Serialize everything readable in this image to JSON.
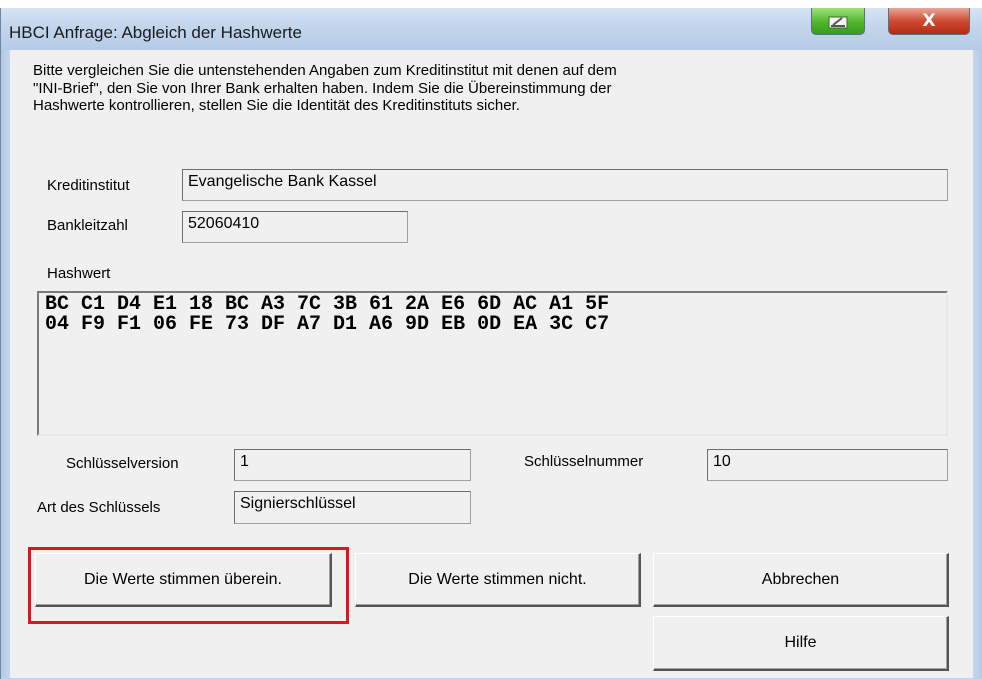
{
  "window": {
    "title": "HBCI Anfrage: Abgleich der Hashwerte",
    "minimize_icon": "minimize-icon",
    "close_icon": "close-icon",
    "close_glyph": "X"
  },
  "description": "Bitte vergleichen Sie die untenstehenden Angaben zum Kreditinstitut mit denen auf dem\n\"INI-Brief\", den Sie von Ihrer Bank erhalten haben. Indem Sie die Übereinstimmung der\nHashwerte kontrollieren, stellen Sie die Identität des Kreditinstituts sicher.",
  "fields": {
    "kreditinstitut": {
      "label": "Kreditinstitut",
      "value": "Evangelische Bank Kassel"
    },
    "bankleitzahl": {
      "label": "Bankleitzahl",
      "value": "52060410"
    },
    "hashwert": {
      "label": "Hashwert",
      "lines": [
        "BC C1 D4 E1 18 BC A3 7C 3B 61 2A E6 6D AC A1 5F",
        "04 F9 F1 06 FE 73 DF A7 D1 A6 9D EB 0D EA 3C C7"
      ]
    },
    "schluesselversion": {
      "label": "Schlüsselversion",
      "value": "1"
    },
    "schluesselnummer": {
      "label": "Schlüsselnummer",
      "value": "10"
    },
    "art": {
      "label": "Art des Schlüssels",
      "value": "Signierschlüssel"
    }
  },
  "buttons": {
    "match": "Die Werte stimmen überein.",
    "mismatch": "Die Werte stimmen nicht.",
    "cancel": "Abbrechen",
    "help": "Hilfe"
  },
  "colors": {
    "highlight": "#e0141e",
    "close_button": "#cf4a30",
    "minimize_button": "#4fb62c",
    "title_bar": "#c2d5ec"
  }
}
